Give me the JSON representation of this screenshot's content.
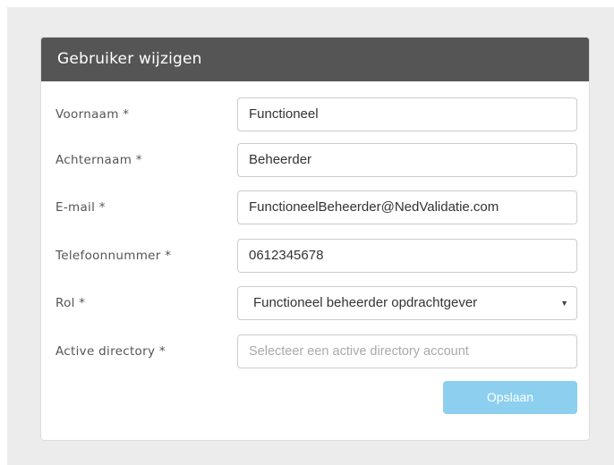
{
  "panel": {
    "title": "Gebruiker wijzigen"
  },
  "form": {
    "fields": [
      {
        "label": "Voornaam *",
        "value": "Functioneel"
      },
      {
        "label": "Achternaam *",
        "value": "Beheerder"
      },
      {
        "label": "E-mail *",
        "value": "FunctioneelBeheerder@NedValidatie.com"
      },
      {
        "label": "Telefoonnummer *",
        "value": "0612345678"
      },
      {
        "label": "Rol *",
        "value": "Functioneel beheerder opdrachtgever",
        "icon": "chevron-down-icon"
      },
      {
        "label": "Active directory *",
        "value": "",
        "placeholder": "Selecteer een active directory account"
      }
    ],
    "save_label": "Opslaan"
  },
  "colors": {
    "header_bg": "#555555",
    "button_bg": "#8dcfee",
    "page_bg": "#ececec"
  }
}
